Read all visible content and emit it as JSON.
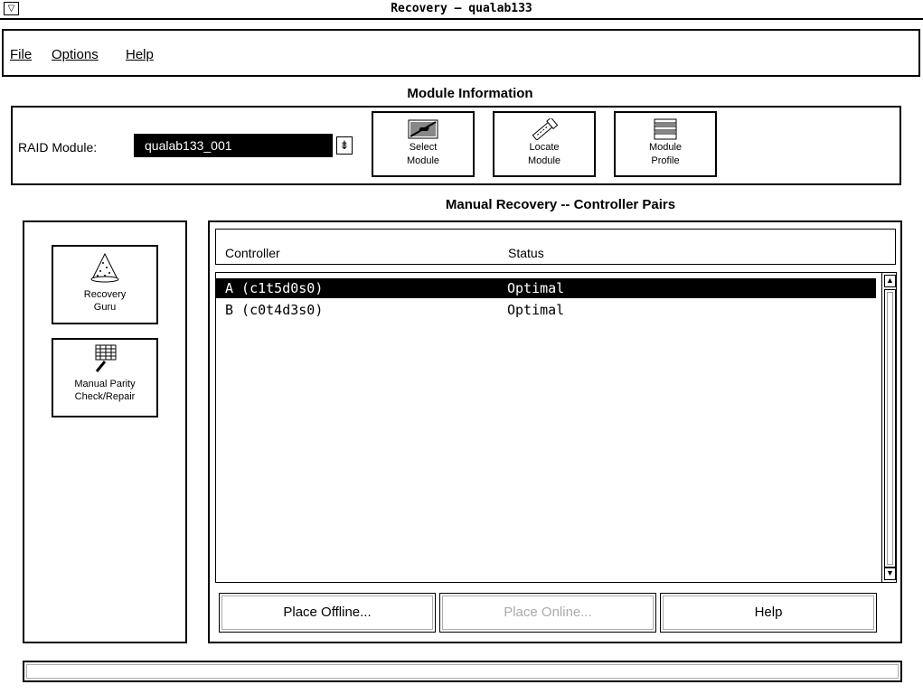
{
  "window": {
    "title": "Recovery – qualab133",
    "menu_glyph": "▽"
  },
  "menubar": {
    "items": [
      "File",
      "Options",
      "Help"
    ]
  },
  "module_info": {
    "title": "Module Information",
    "raid_label": "RAID Module:",
    "raid_value": "qualab133_001",
    "toolbar": {
      "select_module": [
        "Select",
        "Module"
      ],
      "locate_module": [
        "Locate",
        "Module"
      ],
      "module_profile": [
        "Module",
        "Profile"
      ]
    }
  },
  "manual_recovery": {
    "title": "Manual Recovery -- Controller Pairs",
    "side_buttons": {
      "recovery_guru": [
        "Recovery",
        "Guru"
      ],
      "parity": [
        "Manual Parity",
        "Check/Repair"
      ]
    },
    "columns": [
      "Controller",
      "Status"
    ],
    "rows": [
      {
        "controller": "A (c1t5d0s0)",
        "status": "Optimal",
        "selected": true
      },
      {
        "controller": "B (c0t4d3s0)",
        "status": "Optimal",
        "selected": false
      }
    ],
    "buttons": {
      "place_offline": "Place Offline...",
      "place_online": "Place Online...",
      "help": "Help"
    }
  },
  "status_bar": {
    "text": ""
  }
}
